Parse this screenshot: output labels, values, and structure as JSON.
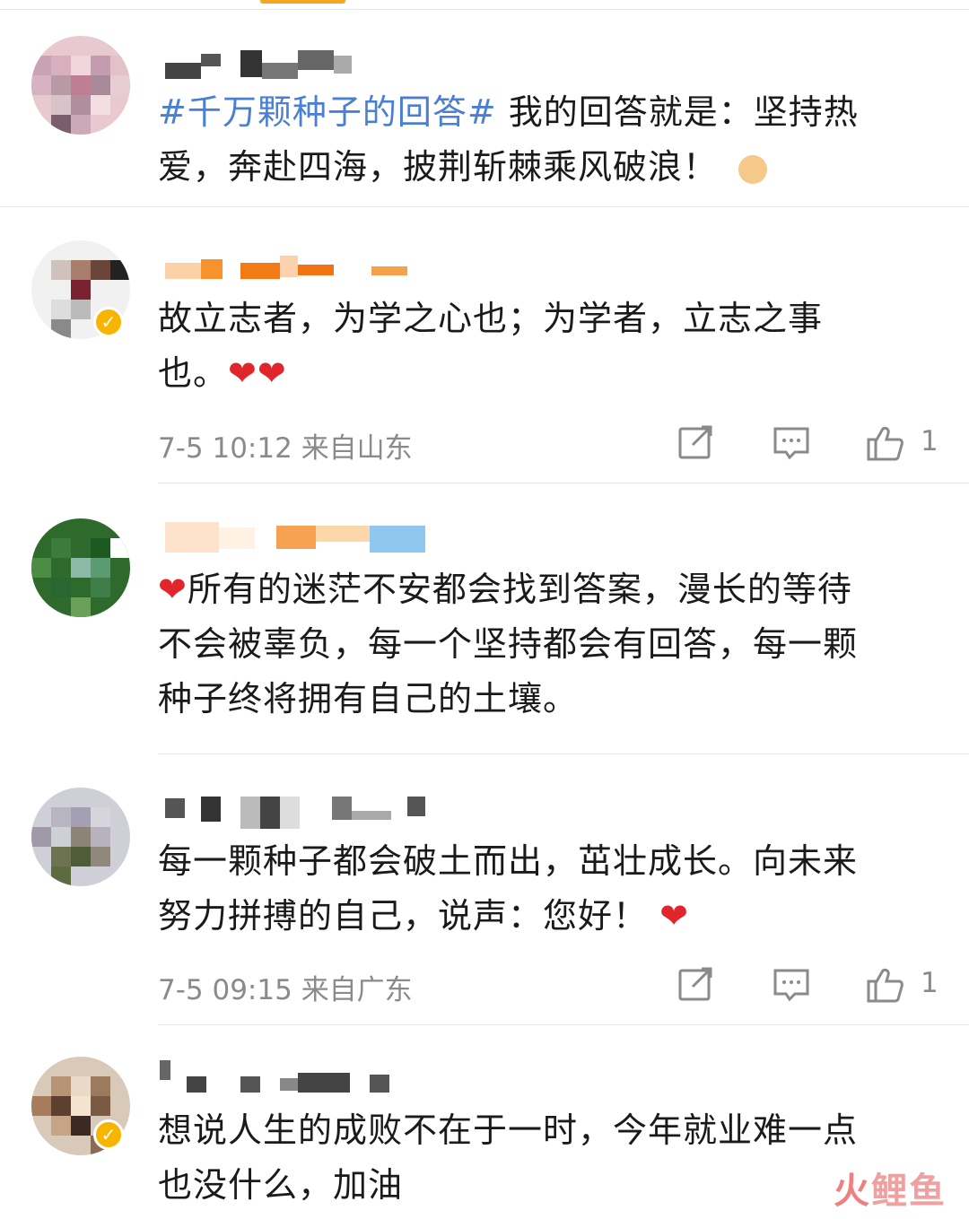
{
  "comments": [
    {
      "text_topic": "#千万颗种子的回答#",
      "text_line1_rest": " 我的回答就是：坚持热",
      "text_line2": "爱，奔赴四海，披荆斩棘乘风破浪！",
      "emoji": "fist-emoji"
    },
    {
      "text_line1": "故立志者，为学之心也；为学者，立志之事",
      "text_line2": "也。",
      "emoji": "❤❤",
      "time": "7-5 10:12",
      "source": "来自山东",
      "like_count": "1",
      "verified": true
    },
    {
      "emoji_lead": "❤",
      "text_line1": "所有的迷茫不安都会找到答案，漫长的等待",
      "text_line2": "不会被辜负，每一个坚持都会有回答，每一颗",
      "text_line3": "种子终将拥有自己的土壤。"
    },
    {
      "text_line1": "每一颗种子都会破土而出，茁壮成长。向未来",
      "text_line2": "努力拼搏的自己，说声：您好！",
      "emoji": "❤",
      "time": "7-5 09:15",
      "source": "来自广东",
      "like_count": "1"
    },
    {
      "text_line1": "想说人生的成败不在于一时，今年就业难一点",
      "text_line2": "也没什么，加油",
      "verified": true
    }
  ],
  "icons": {
    "share": "share-icon",
    "comment": "comment-icon",
    "like": "thumbs-up-icon"
  },
  "watermark": {
    "part1": "火",
    "part2": "鲤鱼"
  },
  "colors": {
    "topic": "#4a7fd4",
    "heart": "#e0262a",
    "verified": "#f7b500",
    "meta": "#8a8a8a"
  }
}
